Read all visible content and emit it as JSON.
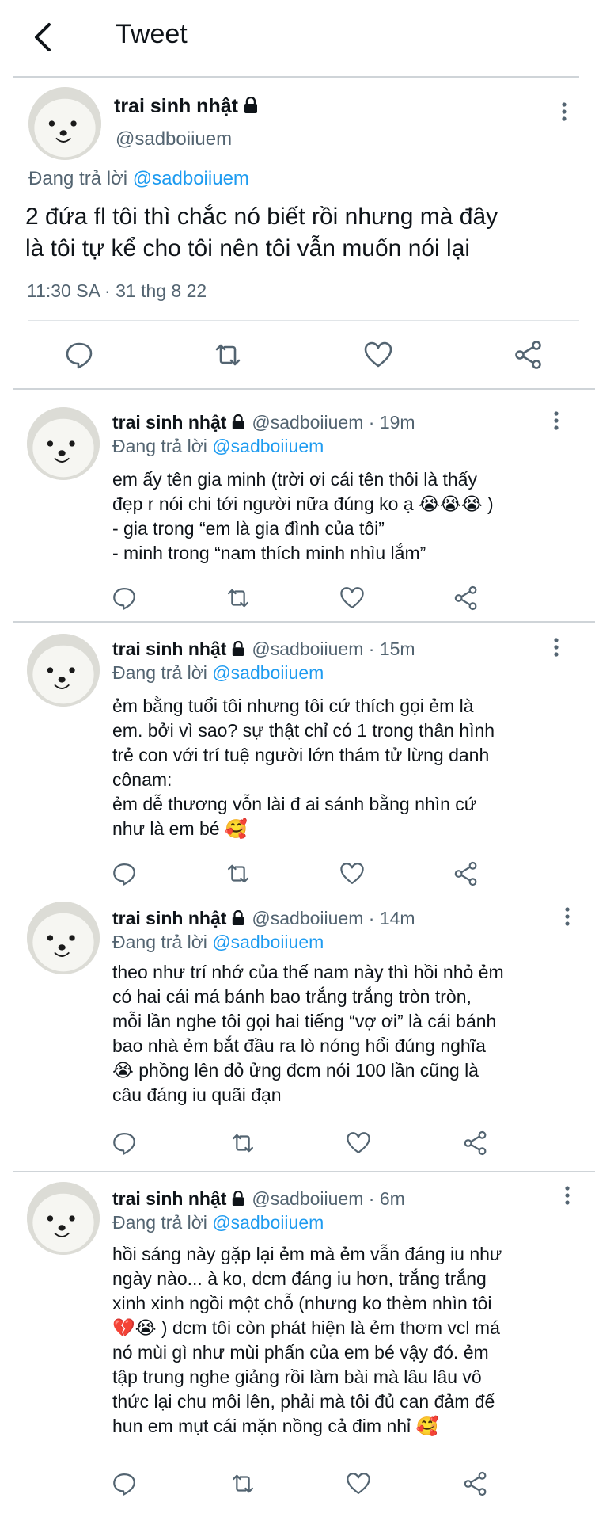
{
  "header": {
    "title": "Tweet"
  },
  "main_tweet": {
    "name": "trai sinh nhật",
    "handle": "@sadboiiuem",
    "reply_prefix": "Đang trả lời",
    "reply_to": "@sadboiiuem",
    "text": "2 đứa fl tôi thì chắc nó biết rồi nhưng mà đây\nlà tôi tự kể cho tôi nên tôi vẫn muốn nói lại",
    "timestamp": "11:30 SA · 31 thg 8 22"
  },
  "replies": [
    {
      "name": "trai sinh nhật",
      "handle_meta": "@sadboiiuem · 19m",
      "reply_prefix": "Đang trả lời",
      "reply_to": "@sadboiiuem",
      "text": "em ấy tên gia minh (trời ơi cái tên thôi là thấy\nđẹp r nói chi tới người nữa đúng ko ạ 😭😭😭 )\n- gia trong “em là gia đình của tôi”\n- minh trong “nam thích minh nhìu lắm”"
    },
    {
      "name": "trai sinh nhật",
      "handle_meta": "@sadboiiuem · 15m",
      "reply_prefix": "Đang trả lời",
      "reply_to": "@sadboiiuem",
      "text": "ẻm bằng tuổi tôi nhưng tôi cứ thích gọi ẻm là\nem. bởi vì sao? sự thật chỉ có 1 trong thân hình\ntrẻ con với trí tuệ người lớn thám tử lừng danh\ncônam:\nẻm dễ thương vỗn lài đ ai sánh bằng nhìn cứ\nnhư là em bé 🥰"
    },
    {
      "name": "trai sinh nhật",
      "handle_meta": "@sadboiiuem · 14m",
      "reply_prefix": "Đang trả lời",
      "reply_to": "@sadboiiuem",
      "text": "theo như trí nhớ của thế nam này thì hồi nhỏ ẻm\ncó hai cái má bánh bao trắng trắng tròn tròn,\nmỗi lần nghe tôi gọi hai tiếng “vợ ơi” là cái bánh\nbao nhà ẻm bắt đầu ra lò nóng hổi đúng nghĩa\n😭 phồng lên đỏ ửng đcm nói 100 lần cũng là\ncâu đáng iu quãi đạn"
    },
    {
      "name": "trai sinh nhật",
      "handle_meta": "@sadboiiuem · 6m",
      "reply_prefix": "Đang trả lời",
      "reply_to": "@sadboiiuem",
      "text": "hồi sáng này gặp lại ẻm mà ẻm vẫn đáng iu như\nngày nào... à ko, dcm đáng iu hơn, trắng trắng\nxinh xinh ngồi một chỗ (nhưng ko thèm nhìn tôi\n💔😭 ) dcm tôi còn phát hiện là ẻm thơm vcl má\nnó mùi gì như mùi phấn của em bé vậy đó. ẻm\ntập trung nghe giảng rồi làm bài mà lâu lâu vô\nthức lại chu môi lên, phải mà tôi đủ can đảm để\nhun em mụt cái mặn nồng cả đim nhỉ 🥰"
    }
  ],
  "colors": {
    "text": "#0f1419",
    "secondary": "#536471",
    "link": "#1d9bf0",
    "divider": "#cfd4d8"
  }
}
